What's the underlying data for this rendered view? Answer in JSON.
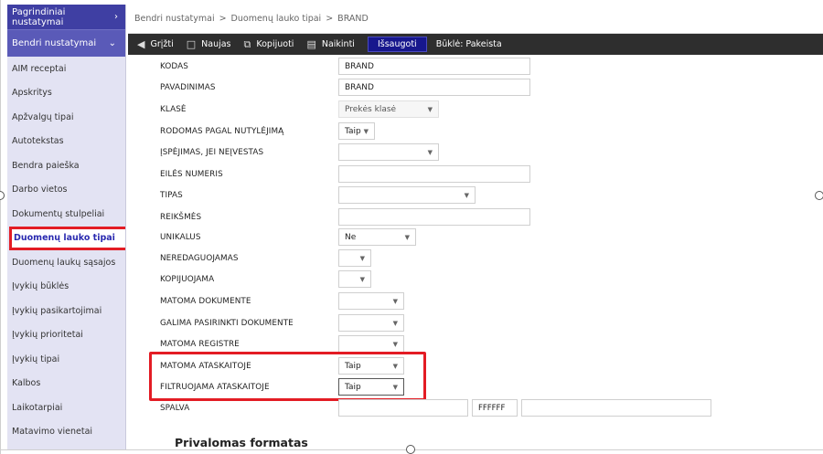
{
  "sidebar": {
    "top_label": "Pagrindiniai nustatymai",
    "top_chevron": "›",
    "section_label": "Bendri nustatymai",
    "section_chevron": "⌄",
    "items": [
      {
        "label": "AIM receptai"
      },
      {
        "label": "Apskritys"
      },
      {
        "label": "Apžvalgų tipai"
      },
      {
        "label": "Autotekstas"
      },
      {
        "label": "Bendra paieška"
      },
      {
        "label": "Darbo vietos"
      },
      {
        "label": "Dokumentų stulpeliai"
      },
      {
        "label": "Duomenų lauko tipai",
        "active": true
      },
      {
        "label": "Duomenų laukų sąsajos"
      },
      {
        "label": "Įvykių būklės"
      },
      {
        "label": "Įvykių pasikartojimai"
      },
      {
        "label": "Įvykių prioritetai"
      },
      {
        "label": "Įvykių tipai"
      },
      {
        "label": "Kalbos"
      },
      {
        "label": "Laikotarpiai"
      },
      {
        "label": "Matavimo vienetai"
      }
    ]
  },
  "breadcrumb": {
    "part1": "Bendri nustatymai",
    "part2": "Duomenų lauko tipai",
    "part3": "BRAND",
    "separator": ">"
  },
  "toolbar": {
    "back_icon": "circle-left-icon",
    "back_label": "Grįžti",
    "new_icon": "document-icon",
    "new_label": "Naujas",
    "copy_icon": "copy-icon",
    "copy_label": "Kopijuoti",
    "delete_icon": "trash-icon",
    "delete_label": "Naikinti",
    "save_label": "Išsaugoti",
    "status_label": "Būklė: Pakeista"
  },
  "form": {
    "kodas": {
      "label": "KODAS",
      "value": "BRAND"
    },
    "pavadinimas": {
      "label": "PAVADINIMAS",
      "value": "BRAND"
    },
    "klase": {
      "label": "KLASĖ",
      "value": "Prekės klasė"
    },
    "rodomas": {
      "label": "RODOMAS PAGAL NUTYLĖJIMĄ",
      "value": "Taip"
    },
    "ispejimas": {
      "label": "ĮSPĖJIMAS, JEI NEĮVESTAS",
      "value": ""
    },
    "eiles": {
      "label": "EILĖS NUMERIS",
      "value": ""
    },
    "tipas": {
      "label": "TIPAS",
      "value": ""
    },
    "reiksmes": {
      "label": "REIKŠMĖS",
      "value": ""
    },
    "unikalus": {
      "label": "UNIKALUS",
      "value": "Ne"
    },
    "neredaguojamas": {
      "label": "NEREDAGUOJAMAS",
      "value": ""
    },
    "kopijuojama": {
      "label": "KOPIJUOJAMA",
      "value": ""
    },
    "matoma_dok": {
      "label": "MATOMA DOKUMENTE",
      "value": ""
    },
    "galima_dok": {
      "label": "GALIMA PASIRINKTI DOKUMENTE",
      "value": ""
    },
    "matoma_reg": {
      "label": "MATOMA REGISTRE",
      "value": ""
    },
    "matoma_atask": {
      "label": "MATOMA ATASKAITOJE",
      "value": "Taip"
    },
    "filtruojama": {
      "label": "FILTRUOJAMA ATASKAITOJE",
      "value": "Taip"
    },
    "spalva": {
      "label": "SPALVA",
      "value": "",
      "hex": "FFFFFF",
      "extra": ""
    }
  },
  "section_title": "Privalomas formatas",
  "colors": {
    "sidebar_top": "#3f3fa3",
    "sidebar_section": "#5a5ab8",
    "highlight": "#e31c24",
    "toolbar": "#2e2e2e",
    "save_button": "#17178d"
  }
}
